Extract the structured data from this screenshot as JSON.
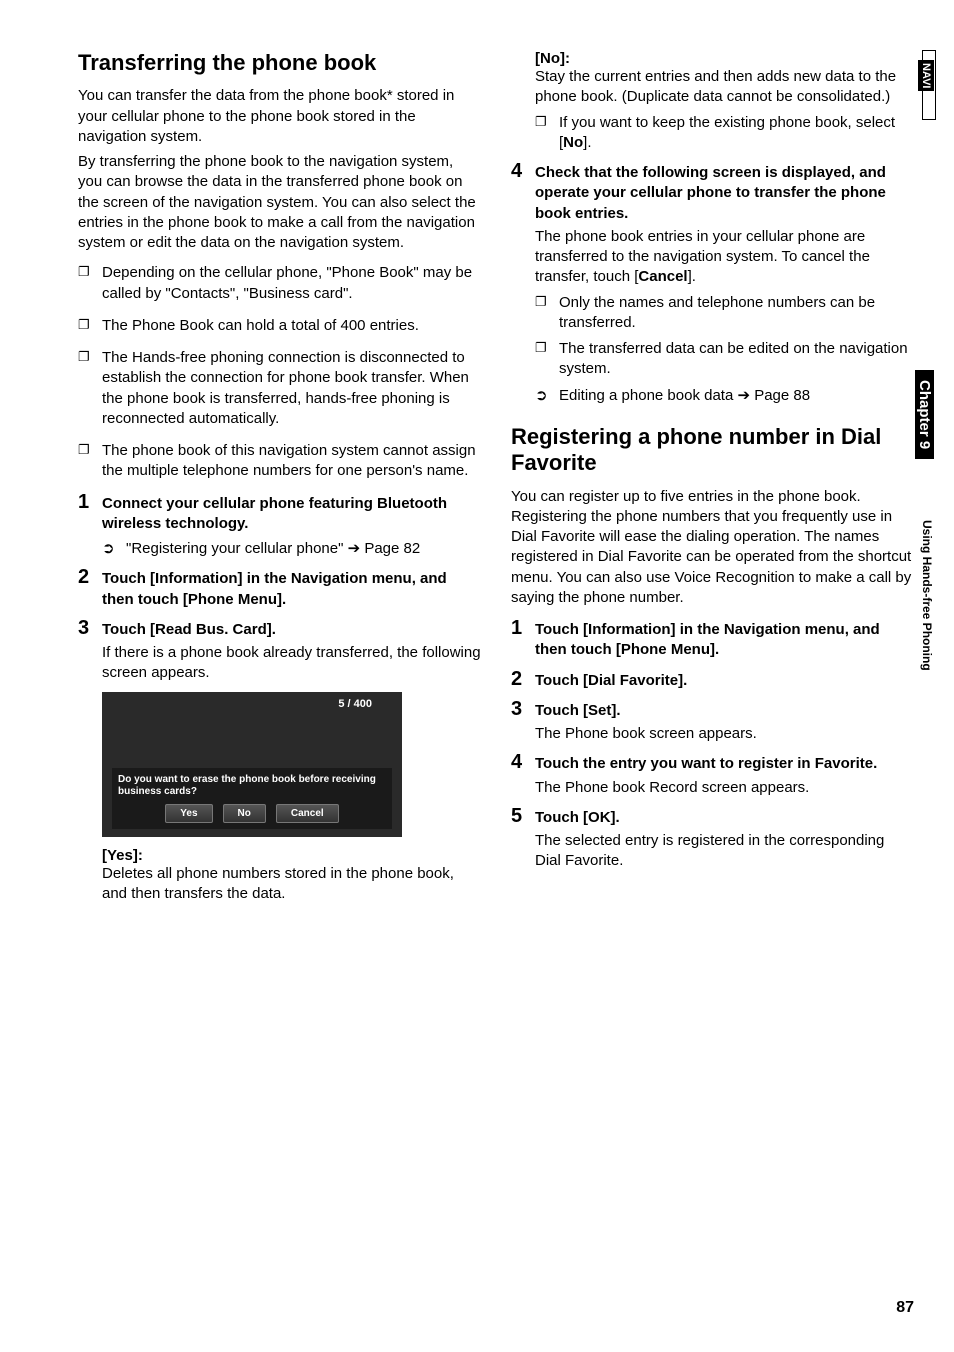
{
  "left": {
    "title": "Transferring the phone book",
    "intro1": "You can transfer the data from the phone book* stored in your cellular phone to the phone book stored in the navigation system.",
    "intro2": "By transferring the phone book to the navigation system, you can browse the data in the transferred phone book on the screen of the navigation system. You can also select the entries in the phone book to make a call from the navigation system or edit the data on the navigation system.",
    "bullets": [
      "Depending on the cellular phone, \"Phone Book\" may be called by \"Contacts\", \"Business card\".",
      "The Phone Book can hold a total of 400 entries.",
      "The Hands-free phoning connection is disconnected to establish the connection for phone book transfer. When the phone book is transferred, hands-free phoning is reconnected automatically.",
      "The phone book of this navigation system cannot assign the multiple telephone numbers for one person's name."
    ],
    "step1": {
      "title": "Connect your cellular phone featuring Bluetooth wireless technology.",
      "ref": "\"Registering your cellular phone\" ➔ Page 82"
    },
    "step2": {
      "title": "Touch [Information] in the Navigation menu, and then touch [Phone Menu]."
    },
    "step3": {
      "title": "Touch [Read Bus. Card].",
      "body": "If there is a phone book already transferred, the following screen appears."
    },
    "screenshot": {
      "count": "5 / 400",
      "prompt": "Do you want to erase the phone book before receiving business cards?",
      "buttons": [
        "Yes",
        "No",
        "Cancel"
      ]
    },
    "yes": {
      "label": "[Yes]:",
      "body": "Deletes all phone numbers stored in the phone book, and then transfers the data."
    }
  },
  "right": {
    "no": {
      "label": "[No]:",
      "body": "Stay the current entries and then adds new data to the phone book. (Duplicate data cannot be consolidated.)",
      "bullet_pre": "If you want to keep the existing phone book, select [",
      "bullet_bold": "No",
      "bullet_post": "]."
    },
    "step4": {
      "title": "Check that the following screen is displayed, and operate your cellular phone to transfer the phone book entries.",
      "body_pre": "The phone book entries in your cellular phone are transferred to the navigation system. To cancel the transfer, touch [",
      "body_bold": "Cancel",
      "body_post": "].",
      "subbullets": [
        "Only the names and telephone numbers can be transferred.",
        "The transferred data can be edited on the navigation system."
      ],
      "ref": "Editing a phone book data ➔ Page 88"
    },
    "section2": {
      "title": "Registering a phone number in Dial Favorite",
      "intro": "You can register up to five entries in the phone book. Registering the phone numbers that you frequently use in Dial Favorite will ease the dialing operation. The names registered in Dial Favorite can be operated from the shortcut menu. You can also use Voice Recognition to make a call by saying the phone number.",
      "steps": [
        {
          "title": "Touch [Information] in the Navigation menu, and then touch [Phone Menu]."
        },
        {
          "title": "Touch [Dial Favorite]."
        },
        {
          "title": "Touch [Set].",
          "body": "The Phone book screen appears."
        },
        {
          "title": "Touch the entry you want to register in Favorite.",
          "body": "The Phone book Record screen appears."
        },
        {
          "title": "Touch [OK].",
          "body": "The selected entry is registered in the corresponding Dial Favorite."
        }
      ]
    }
  },
  "sidebar": {
    "navi": "NAVI",
    "chapter": "Chapter 9",
    "subtitle": "Using Hands-free Phoning"
  },
  "page_number": "87"
}
